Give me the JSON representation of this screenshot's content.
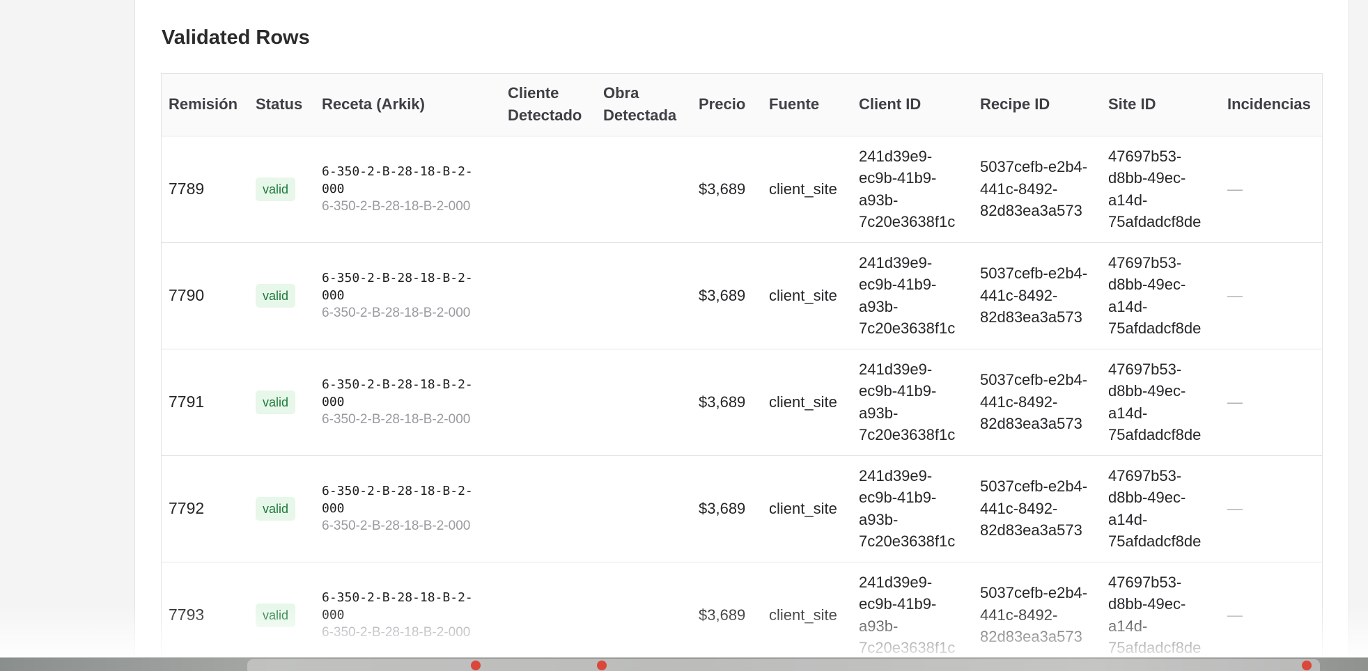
{
  "card": {
    "title": "Validated Rows"
  },
  "table": {
    "headers": {
      "remision": "Remisión",
      "status": "Status",
      "receta": "Receta (Arkik)",
      "cliente": "Cliente Detectado",
      "obra": "Obra Detectada",
      "precio": "Precio",
      "fuente": "Fuente",
      "client_id": "Client ID",
      "recipe_id": "Recipe ID",
      "site_id": "Site ID",
      "incidencias": "Incidencias"
    },
    "rows": [
      {
        "remision": "7789",
        "status": "valid",
        "receta_main": "6-350-2-B-28-18-B-2-000",
        "receta_sub": "6-350-2-B-28-18-B-2-000",
        "cliente": "",
        "obra": "",
        "precio": "$3,689",
        "fuente": "client_site",
        "client_id": "241d39e9-ec9b-41b9-a93b-7c20e3638f1c",
        "recipe_id": "5037cefb-e2b4-441c-8492-82d83ea3a573",
        "site_id": "47697b53-d8bb-49ec-a14d-75afdadcf8de",
        "incidencias": "—"
      },
      {
        "remision": "7790",
        "status": "valid",
        "receta_main": "6-350-2-B-28-18-B-2-000",
        "receta_sub": "6-350-2-B-28-18-B-2-000",
        "cliente": "",
        "obra": "",
        "precio": "$3,689",
        "fuente": "client_site",
        "client_id": "241d39e9-ec9b-41b9-a93b-7c20e3638f1c",
        "recipe_id": "5037cefb-e2b4-441c-8492-82d83ea3a573",
        "site_id": "47697b53-d8bb-49ec-a14d-75afdadcf8de",
        "incidencias": "—"
      },
      {
        "remision": "7791",
        "status": "valid",
        "receta_main": "6-350-2-B-28-18-B-2-000",
        "receta_sub": "6-350-2-B-28-18-B-2-000",
        "cliente": "",
        "obra": "",
        "precio": "$3,689",
        "fuente": "client_site",
        "client_id": "241d39e9-ec9b-41b9-a93b-7c20e3638f1c",
        "recipe_id": "5037cefb-e2b4-441c-8492-82d83ea3a573",
        "site_id": "47697b53-d8bb-49ec-a14d-75afdadcf8de",
        "incidencias": "—"
      },
      {
        "remision": "7792",
        "status": "valid",
        "receta_main": "6-350-2-B-28-18-B-2-000",
        "receta_sub": "6-350-2-B-28-18-B-2-000",
        "cliente": "",
        "obra": "",
        "precio": "$3,689",
        "fuente": "client_site",
        "client_id": "241d39e9-ec9b-41b9-a93b-7c20e3638f1c",
        "recipe_id": "5037cefb-e2b4-441c-8492-82d83ea3a573",
        "site_id": "47697b53-d8bb-49ec-a14d-75afdadcf8de",
        "incidencias": "—"
      },
      {
        "remision": "7793",
        "status": "valid",
        "receta_main": "6-350-2-B-28-18-B-2-000",
        "receta_sub": "6-350-2-B-28-18-B-2-000",
        "cliente": "",
        "obra": "",
        "precio": "$3,689",
        "fuente": "client_site",
        "client_id": "241d39e9-ec9b-41b9-a93b-7c20e3638f1c",
        "recipe_id": "5037cefb-e2b4-441c-8492-82d83ea3a573",
        "site_id": "47697b53-d8bb-49ec-a14d-75afdadcf8de",
        "incidencias": "—"
      }
    ]
  },
  "colors": {
    "badge_bg": "#e7f7ea",
    "badge_text": "#1f7a3a",
    "page_bg": "#f4f4f5",
    "card_bg": "#ffffff",
    "border": "#e4e4e7"
  },
  "icons": {
    "taskbar_dots": [
      "app-icon",
      "app-icon",
      "app-icon"
    ]
  }
}
